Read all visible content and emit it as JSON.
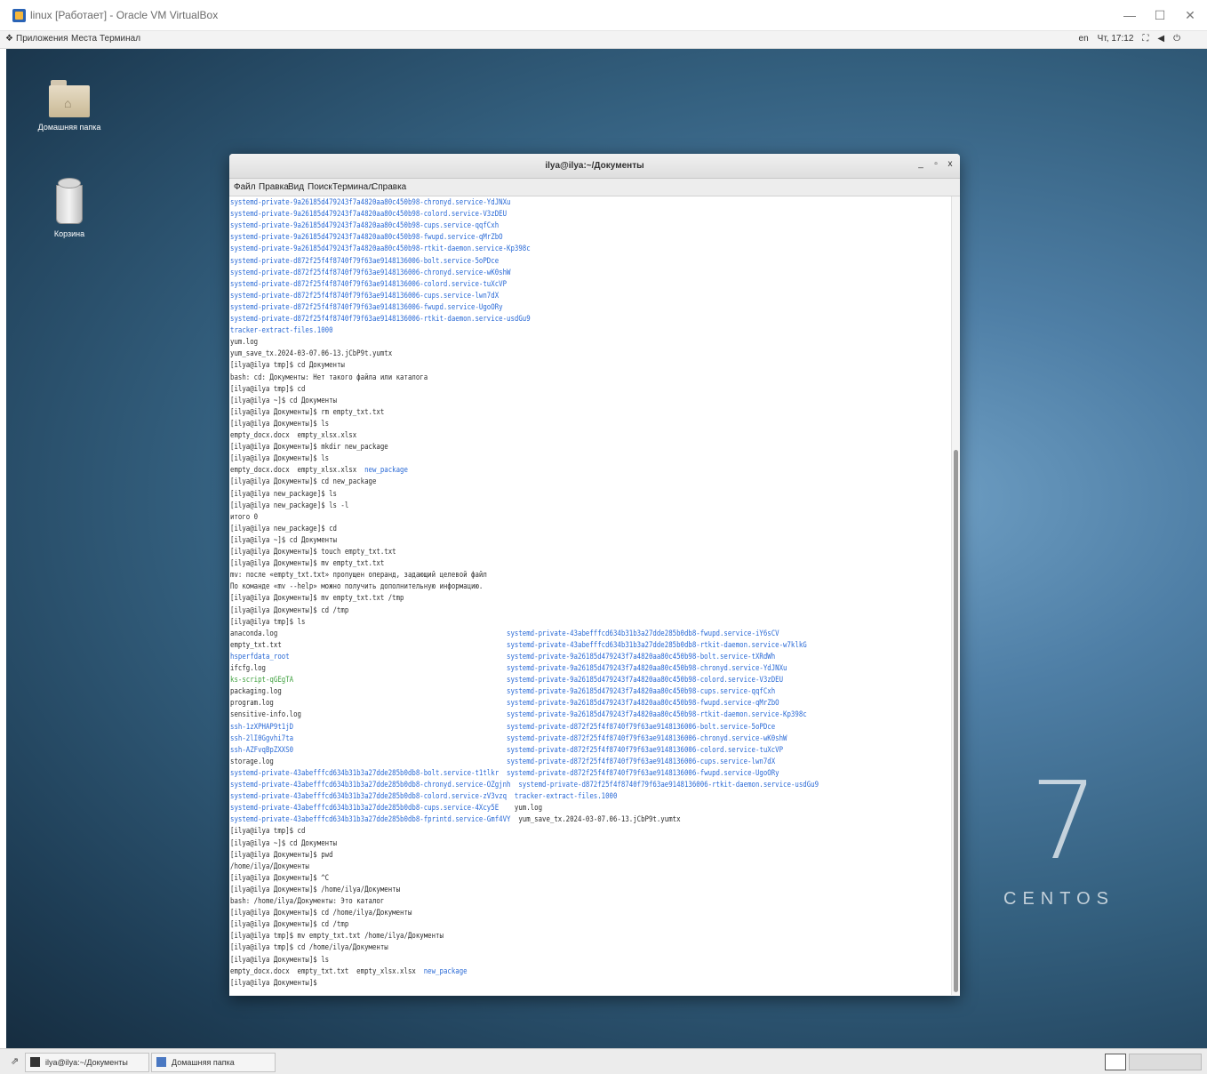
{
  "host_window": {
    "title": "linux [Работает] - Oracle VM VirtualBox",
    "controls": [
      "—",
      "☐",
      "✕"
    ]
  },
  "guest_panel": {
    "menus": [
      "Приложения",
      "Места",
      "Терминал"
    ],
    "keyboard": "en",
    "clock": "Чт, 17:12"
  },
  "desktop": {
    "icons": [
      {
        "label": "Домашняя папка",
        "icon": "home-folder-icon"
      },
      {
        "label": "Корзина",
        "icon": "trash-icon"
      }
    ],
    "branding": {
      "number": "7",
      "word": "CENTOS"
    }
  },
  "terminal": {
    "title": "ilya@ilya:~/Документы",
    "controls": [
      "_",
      "▫",
      "x"
    ],
    "menu": [
      "Файл",
      "Правка",
      "Вид",
      "Поиск",
      "Терминал",
      "Справка"
    ],
    "lines": [
      [
        {
          "t": "systemd-private-9a26185d479243f7a4820aa80c450b98-chronyd.service-YdJNXu",
          "c": "blue"
        }
      ],
      [
        {
          "t": "systemd-private-9a26185d479243f7a4820aa80c450b98-colord.service-V3zDEU",
          "c": "blue"
        }
      ],
      [
        {
          "t": "systemd-private-9a26185d479243f7a4820aa80c450b98-cups.service-qqfCxh",
          "c": "blue"
        }
      ],
      [
        {
          "t": "systemd-private-9a26185d479243f7a4820aa80c450b98-fwupd.service-qMrZbO",
          "c": "blue"
        }
      ],
      [
        {
          "t": "systemd-private-9a26185d479243f7a4820aa80c450b98-rtkit-daemon.service-Kp398c",
          "c": "blue"
        }
      ],
      [
        {
          "t": "systemd-private-d872f25f4f8740f79f63ae9148136006-bolt.service-5oPDce",
          "c": "blue"
        }
      ],
      [
        {
          "t": "systemd-private-d872f25f4f8740f79f63ae9148136006-chronyd.service-wK0shW",
          "c": "blue"
        }
      ],
      [
        {
          "t": "systemd-private-d872f25f4f8740f79f63ae9148136006-colord.service-tuXcVP",
          "c": "blue"
        }
      ],
      [
        {
          "t": "systemd-private-d872f25f4f8740f79f63ae9148136006-cups.service-lwn7dX",
          "c": "blue"
        }
      ],
      [
        {
          "t": "systemd-private-d872f25f4f8740f79f63ae9148136006-fwupd.service-UgoORy",
          "c": "blue"
        }
      ],
      [
        {
          "t": "systemd-private-d872f25f4f8740f79f63ae9148136006-rtkit-daemon.service-usdGu9",
          "c": "blue"
        }
      ],
      [
        {
          "t": "tracker-extract-files.1000",
          "c": "blue"
        }
      ],
      [
        {
          "t": "yum.log"
        }
      ],
      [
        {
          "t": "yum_save_tx.2024-03-07.06-13.jCbP9t.yumtx"
        }
      ],
      [
        {
          "t": "[ilya@ilya tmp]$ cd Документы"
        }
      ],
      [
        {
          "t": "bash: cd: Документы: Нет такого файла или каталога"
        }
      ],
      [
        {
          "t": "[ilya@ilya tmp]$ cd"
        }
      ],
      [
        {
          "t": "[ilya@ilya ~]$ cd Документы"
        }
      ],
      [
        {
          "t": "[ilya@ilya Документы]$ rm empty_txt.txt"
        }
      ],
      [
        {
          "t": "[ilya@ilya Документы]$ ls"
        }
      ],
      [
        {
          "t": "empty_docx.docx  empty_xlsx.xlsx"
        }
      ],
      [
        {
          "t": "[ilya@ilya Документы]$ mkdir new_package"
        }
      ],
      [
        {
          "t": "[ilya@ilya Документы]$ ls"
        }
      ],
      [
        {
          "t": "empty_docx.docx  empty_xlsx.xlsx  "
        },
        {
          "t": "new_package",
          "c": "blue"
        }
      ],
      [
        {
          "t": "[ilya@ilya Документы]$ cd new_package"
        }
      ],
      [
        {
          "t": "[ilya@ilya new_package]$ ls"
        }
      ],
      [
        {
          "t": "[ilya@ilya new_package]$ ls -l"
        }
      ],
      [
        {
          "t": "итого 0"
        }
      ],
      [
        {
          "t": "[ilya@ilya new_package]$ cd"
        }
      ],
      [
        {
          "t": "[ilya@ilya ~]$ cd Документы"
        }
      ],
      [
        {
          "t": "[ilya@ilya Документы]$ touch empty_txt.txt"
        }
      ],
      [
        {
          "t": "[ilya@ilya Документы]$ mv empty_txt.txt"
        }
      ],
      [
        {
          "t": "mv: после «empty_txt.txt» пропущен операнд, задающий целевой файл"
        }
      ],
      [
        {
          "t": "По команде «mv --help» можно получить дополнительную информацию."
        }
      ],
      [
        {
          "t": "[ilya@ilya Документы]$ mv empty_txt.txt /tmp"
        }
      ],
      [
        {
          "t": "[ilya@ilya Документы]$ cd /tmp"
        }
      ],
      [
        {
          "t": "[ilya@ilya tmp]$ ls"
        }
      ],
      [
        {
          "t": "anaconda.log                                                          "
        },
        {
          "t": "systemd-private-43abefffcd634b31b3a27dde285b0db8-fwupd.service-iY6sCV",
          "c": "blue"
        }
      ],
      [
        {
          "t": "empty_txt.txt                                                         "
        },
        {
          "t": "systemd-private-43abefffcd634b31b3a27dde285b0db8-rtkit-daemon.service-w7klkG",
          "c": "blue"
        }
      ],
      [
        {
          "t": "hsperfdata_root",
          "c": "blue"
        },
        {
          "t": "                                                       "
        },
        {
          "t": "systemd-private-9a26185d479243f7a4820aa80c450b98-bolt.service-tXRdWh",
          "c": "blue"
        }
      ],
      [
        {
          "t": "ifcfg.log                                                             "
        },
        {
          "t": "systemd-private-9a26185d479243f7a4820aa80c450b98-chronyd.service-YdJNXu",
          "c": "blue"
        }
      ],
      [
        {
          "t": "ks-script-qGEgTA",
          "c": "green"
        },
        {
          "t": "                                                      "
        },
        {
          "t": "systemd-private-9a26185d479243f7a4820aa80c450b98-colord.service-V3zDEU",
          "c": "blue"
        }
      ],
      [
        {
          "t": "packaging.log                                                         "
        },
        {
          "t": "systemd-private-9a26185d479243f7a4820aa80c450b98-cups.service-qqfCxh",
          "c": "blue"
        }
      ],
      [
        {
          "t": "program.log                                                           "
        },
        {
          "t": "systemd-private-9a26185d479243f7a4820aa80c450b98-fwupd.service-qMrZbO",
          "c": "blue"
        }
      ],
      [
        {
          "t": "sensitive-info.log                                                    "
        },
        {
          "t": "systemd-private-9a26185d479243f7a4820aa80c450b98-rtkit-daemon.service-Kp398c",
          "c": "blue"
        }
      ],
      [
        {
          "t": "ssh-1zXPHAP9t1jD",
          "c": "blue"
        },
        {
          "t": "                                                      "
        },
        {
          "t": "systemd-private-d872f25f4f8740f79f63ae9148136006-bolt.service-5oPDce",
          "c": "blue"
        }
      ],
      [
        {
          "t": "ssh-2lI0Ggvhi7ta",
          "c": "blue"
        },
        {
          "t": "                                                      "
        },
        {
          "t": "systemd-private-d872f25f4f8740f79f63ae9148136006-chronyd.service-wK0shW",
          "c": "blue"
        }
      ],
      [
        {
          "t": "ssh-AZFvqBpZXXS0",
          "c": "blue"
        },
        {
          "t": "                                                      "
        },
        {
          "t": "systemd-private-d872f25f4f8740f79f63ae9148136006-colord.service-tuXcVP",
          "c": "blue"
        }
      ],
      [
        {
          "t": "storage.log                                                           "
        },
        {
          "t": "systemd-private-d872f25f4f8740f79f63ae9148136006-cups.service-lwn7dX",
          "c": "blue"
        }
      ],
      [
        {
          "t": "systemd-private-43abefffcd634b31b3a27dde285b0db8-bolt.service-t1tlkr",
          "c": "blue"
        },
        {
          "t": "  "
        },
        {
          "t": "systemd-private-d872f25f4f8740f79f63ae9148136006-fwupd.service-UgoORy",
          "c": "blue"
        }
      ],
      [
        {
          "t": "systemd-private-43abefffcd634b31b3a27dde285b0db8-chronyd.service-OZgjnh",
          "c": "blue"
        },
        {
          "t": "  "
        },
        {
          "t": "systemd-private-d872f25f4f8740f79f63ae9148136006-rtkit-daemon.service-usdGu9",
          "c": "blue"
        }
      ],
      [
        {
          "t": "systemd-private-43abefffcd634b31b3a27dde285b0db8-colord.service-zV3vzq",
          "c": "blue"
        },
        {
          "t": "  "
        },
        {
          "t": "tracker-extract-files.1000",
          "c": "blue"
        }
      ],
      [
        {
          "t": "systemd-private-43abefffcd634b31b3a27dde285b0db8-cups.service-4Xcy5E",
          "c": "blue"
        },
        {
          "t": "    yum.log"
        }
      ],
      [
        {
          "t": "systemd-private-43abefffcd634b31b3a27dde285b0db8-fprintd.service-Gmf4VY",
          "c": "blue"
        },
        {
          "t": "  yum_save_tx.2024-03-07.06-13.jCbP9t.yumtx"
        }
      ],
      [
        {
          "t": "[ilya@ilya tmp]$ cd"
        }
      ],
      [
        {
          "t": "[ilya@ilya ~]$ cd Документы"
        }
      ],
      [
        {
          "t": "[ilya@ilya Документы]$ pwd"
        }
      ],
      [
        {
          "t": "/home/ilya/Документы"
        }
      ],
      [
        {
          "t": "[ilya@ilya Документы]$ ^C"
        }
      ],
      [
        {
          "t": "[ilya@ilya Документы]$ /home/ilya/Документы"
        }
      ],
      [
        {
          "t": "bash: /home/ilya/Документы: Это каталог"
        }
      ],
      [
        {
          "t": "[ilya@ilya Документы]$ cd /home/ilya/Документы"
        }
      ],
      [
        {
          "t": "[ilya@ilya Документы]$ cd /tmp"
        }
      ],
      [
        {
          "t": "[ilya@ilya tmp]$ mv empty_txt.txt /home/ilya/Документы"
        }
      ],
      [
        {
          "t": "[ilya@ilya tmp]$ cd /home/ilya/Документы"
        }
      ],
      [
        {
          "t": "[ilya@ilya Документы]$ ls"
        }
      ],
      [
        {
          "t": "empty_docx.docx  empty_txt.txt  empty_xlsx.xlsx  "
        },
        {
          "t": "new_package",
          "c": "blue"
        }
      ],
      [
        {
          "t": "[ilya@ilya Документы]$ "
        }
      ]
    ]
  },
  "taskbar": {
    "items": [
      {
        "label": "ilya@ilya:~/Документы",
        "icon": "terminal-icon"
      },
      {
        "label": "Домашняя папка",
        "icon": "file-manager-icon"
      }
    ]
  }
}
